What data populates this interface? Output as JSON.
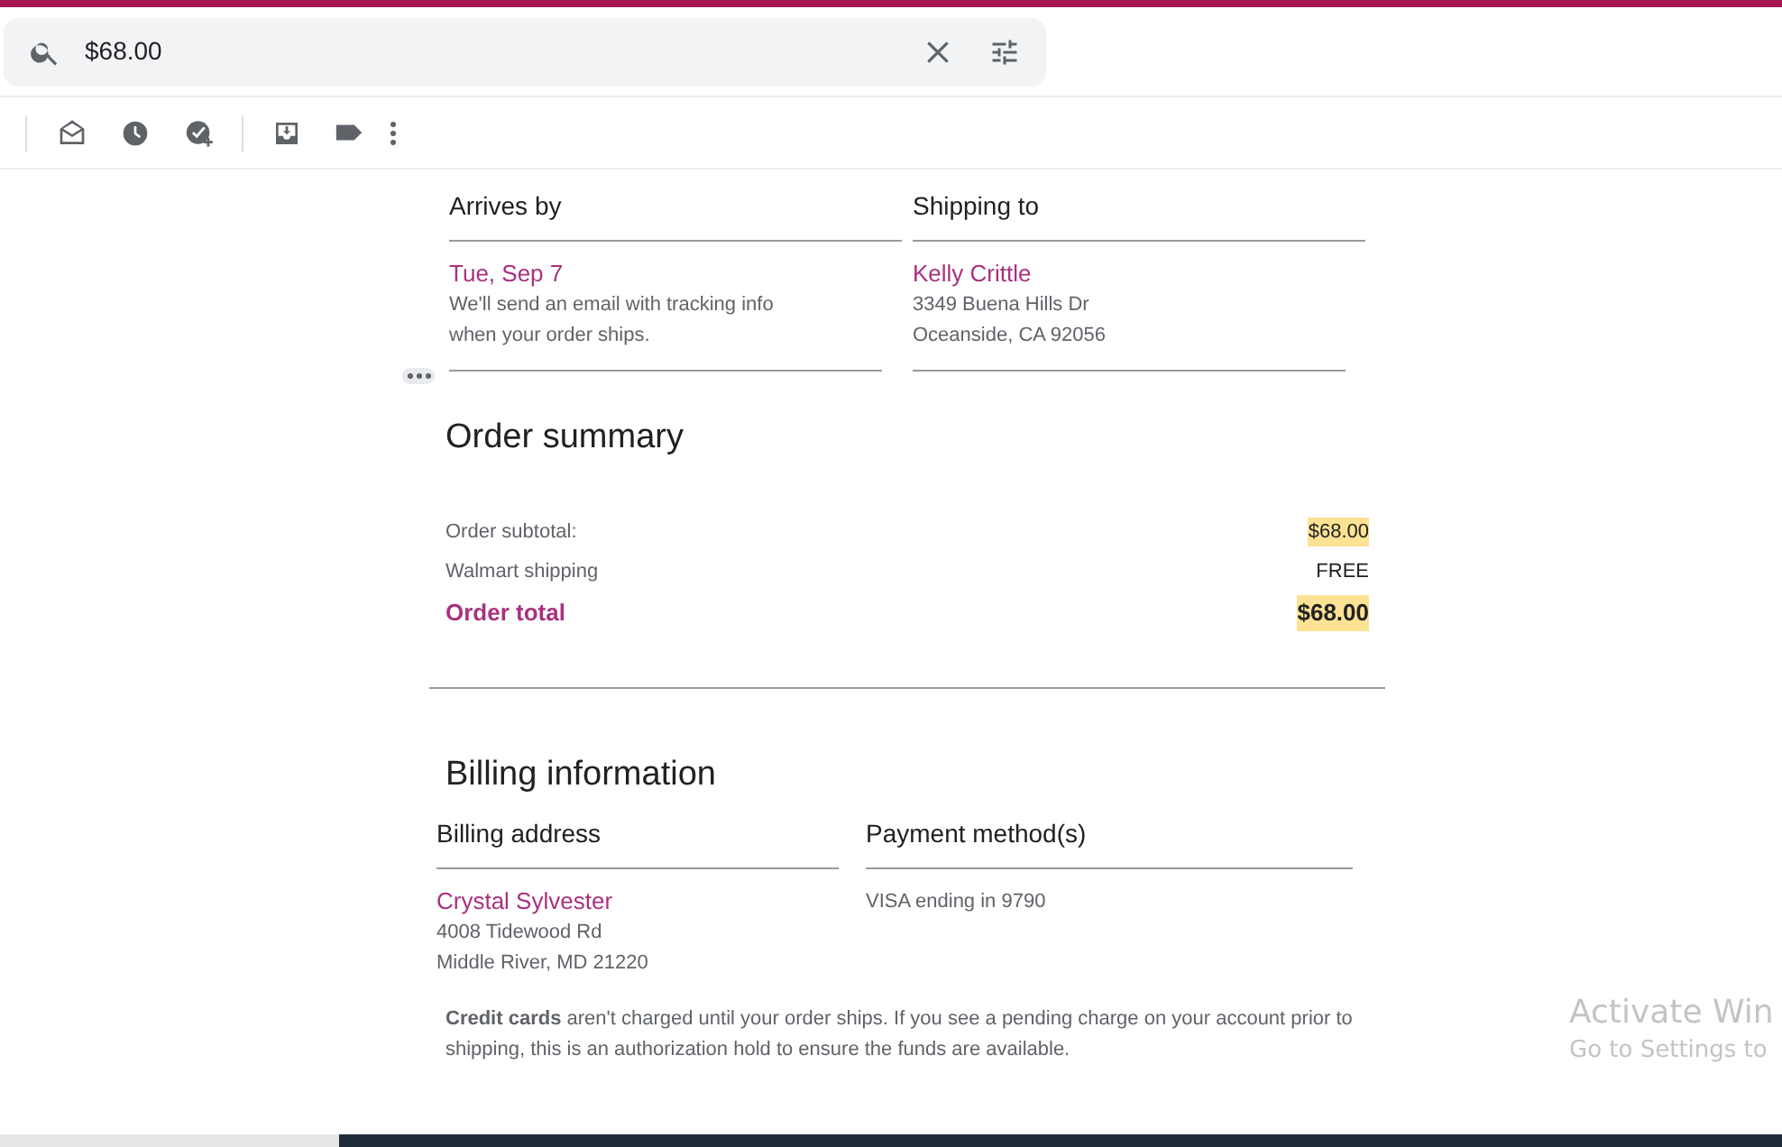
{
  "search": {
    "value": "$68.00"
  },
  "delivery": [
    {
      "heading": "Arrives by",
      "title": "Tue, Sep 7",
      "lines": [
        "We'll send an email with tracking info",
        "when your order ships."
      ]
    },
    {
      "heading": "Shipping to",
      "title": "Kelly Crittle",
      "lines": [
        "3349 Buena Hills Dr",
        "Oceanside, CA 92056"
      ]
    }
  ],
  "order_summary": {
    "title": "Order summary",
    "rows": [
      {
        "kind": "line",
        "label": "Order subtotal:",
        "amount": "$68.00",
        "highlighted": true
      },
      {
        "kind": "line",
        "label": "Walmart shipping",
        "amount": "FREE",
        "highlighted": false
      },
      {
        "kind": "total",
        "label": "Order total",
        "amount": "$68.00",
        "highlighted": true
      }
    ]
  },
  "billing": {
    "title": "Billing information",
    "columns": [
      {
        "heading": "Billing address",
        "title": "Crystal Sylvester",
        "lines": [
          "4008 Tidewood Rd",
          "Middle River, MD 21220"
        ]
      },
      {
        "heading": "Payment method(s)",
        "lines": [
          "VISA ending in 9790"
        ]
      }
    ],
    "note": "**Credit cards** aren't charged until your order ships. If you see a pending charge on your account prior to shipping, this is an authorization hold to ensure the funds are available."
  },
  "os_notice": {
    "title": "Activate Win",
    "subtitle": "Go to Settings to"
  }
}
